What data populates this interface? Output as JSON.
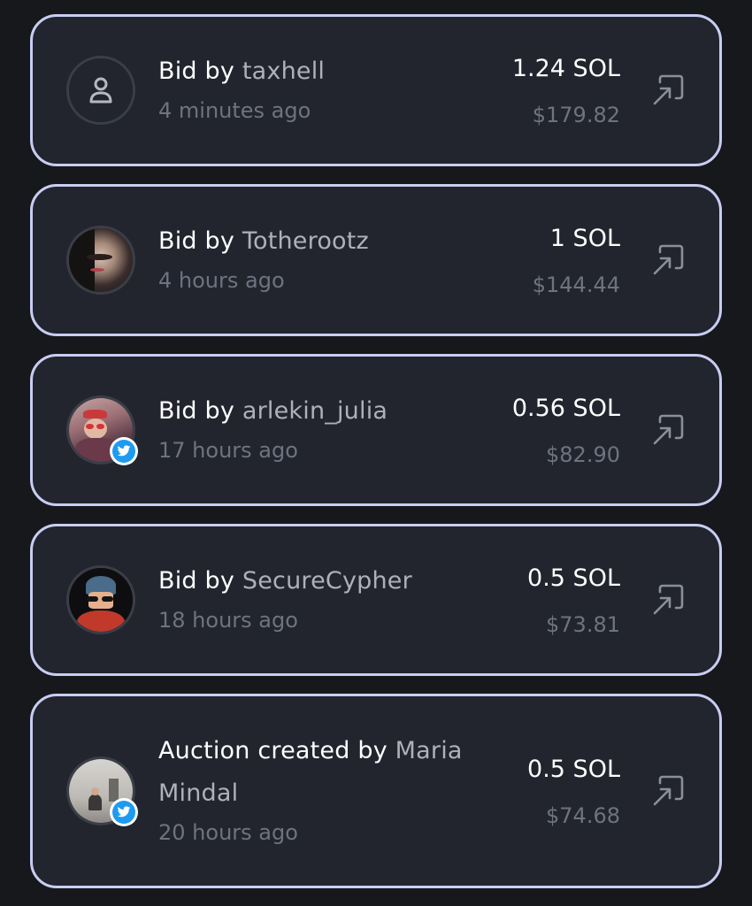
{
  "activity": {
    "items": [
      {
        "prefix": "Bid by",
        "user": "taxhell",
        "time": "4 minutes ago",
        "amount": "1.24 SOL",
        "usd": "$179.82",
        "avatar": "user-placeholder-icon",
        "twitter": false
      },
      {
        "prefix": "Bid by",
        "user": "Totherootz",
        "time": "4 hours ago",
        "amount": "1 SOL",
        "usd": "$144.44",
        "avatar": "profile-photo",
        "twitter": false
      },
      {
        "prefix": "Bid by",
        "user": "arlekin_julia",
        "time": "17 hours ago",
        "amount": "0.56 SOL",
        "usd": "$82.90",
        "avatar": "profile-photo",
        "twitter": true
      },
      {
        "prefix": "Bid by",
        "user": "SecureCypher",
        "time": "18 hours ago",
        "amount": "0.5 SOL",
        "usd": "$73.81",
        "avatar": "profile-photo",
        "twitter": false
      },
      {
        "prefix": "Auction created by",
        "user": "Maria Mindal",
        "time": "20 hours ago",
        "amount": "0.5 SOL",
        "usd": "$74.68",
        "avatar": "profile-photo",
        "twitter": true
      }
    ]
  },
  "colors": {
    "background": "#17181c",
    "card": "#22252e",
    "card_border": "#c9cdf2",
    "text_primary": "#ffffff",
    "text_username": "#aeb1ba",
    "text_muted": "#6e7380",
    "twitter_blue": "#1d9bf0"
  },
  "icons": {
    "open_link": "arrow-up-right-icon",
    "twitter": "twitter-bird-icon"
  }
}
